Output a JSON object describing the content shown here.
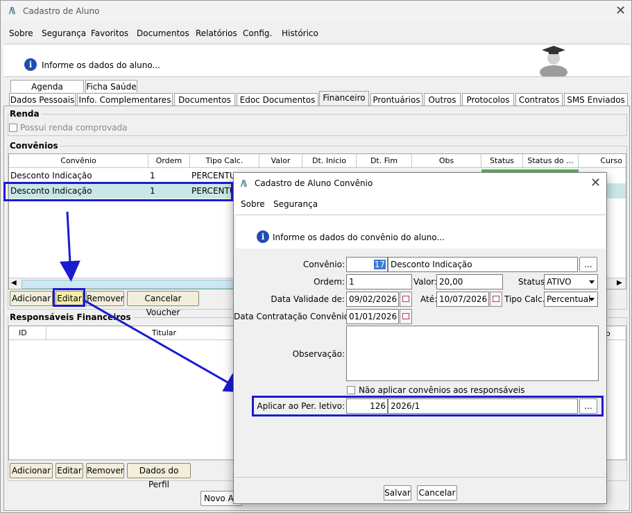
{
  "main": {
    "title": "Cadastro de Aluno",
    "menu": [
      "Sobre",
      "Segurança",
      "Favoritos",
      "Documentos",
      "Relatórios",
      "Config.",
      "Histórico"
    ],
    "info_text": "Informe os dados do aluno...",
    "tabs_row1": [
      "Agenda Avaliação",
      "Ficha Saúde"
    ],
    "tabs_row2": [
      "Dados Pessoais",
      "Info. Complementares",
      "Documentos",
      "Edoc Documentos",
      "Financeiro",
      "Prontuários",
      "Outros",
      "Protocolos",
      "Contratos",
      "SMS Enviados"
    ],
    "active_tab": "Financeiro",
    "renda": {
      "label": "Renda",
      "checkbox_label": "Possui renda comprovada",
      "checked": false
    },
    "convenios": {
      "label": "Convênios",
      "columns": [
        "Convênio",
        "Ordem",
        "Tipo Calc.",
        "Valor",
        "Dt. Inicio",
        "Dt. Fim",
        "Obs",
        "Status",
        "Status do ...",
        "Curso"
      ],
      "rows": [
        {
          "convenio": "Desconto Indicação",
          "ordem": "1",
          "tipo": "PERCENTUAL"
        },
        {
          "convenio": "Desconto Indicação",
          "ordem": "1",
          "tipo": "PERCENTUAL"
        }
      ],
      "buttons": [
        "Adicionar",
        "Editar",
        "Remover",
        "Cancelar Voucher"
      ]
    },
    "responsaveis": {
      "label": "Responsáveis Financeiros",
      "columns": [
        "ID",
        "Titular"
      ],
      "buttons": [
        "Adicionar",
        "Editar",
        "Remover",
        "Dados do Perfil"
      ]
    },
    "bottom_button": "Novo Al"
  },
  "dialog": {
    "title": "Cadastro de Aluno Convênio",
    "menu": [
      "Sobre",
      "Segurança"
    ],
    "info_text": "Informe os dados do convênio do aluno...",
    "fields": {
      "convenio_label": "Convênio:",
      "convenio_id": "17",
      "convenio_name": "Desconto Indicação",
      "ordem_label": "Ordem:",
      "ordem": "1",
      "valor_label": "Valor:",
      "valor": "20,00",
      "status_label": "Status:",
      "status": "ATIVO",
      "validade_label": "Data Validade de:",
      "validade_de": "09/02/2026",
      "ate_label": "Até:",
      "validade_ate": "10/07/2026",
      "tipo_label": "Tipo Calc.:",
      "tipo": "Percentual",
      "contratacao_label": "Data Contratação Convênio:",
      "contratacao": "01/01/2026",
      "observacao_label": "Observação:",
      "observacao": "",
      "nao_aplicar_label": "Não aplicar convênios aos responsáveis",
      "periodo_label": "Aplicar ao Per. letivo:",
      "periodo_id": "126",
      "periodo_name": "2026/1",
      "ellipsis": "..."
    },
    "buttons": {
      "save": "Salvar",
      "cancel": "Cancelar"
    }
  },
  "colors": {
    "highlight_box": "#1a1ad0",
    "selected_row": "#c9e7e7",
    "status_active": "#5cb85c"
  }
}
